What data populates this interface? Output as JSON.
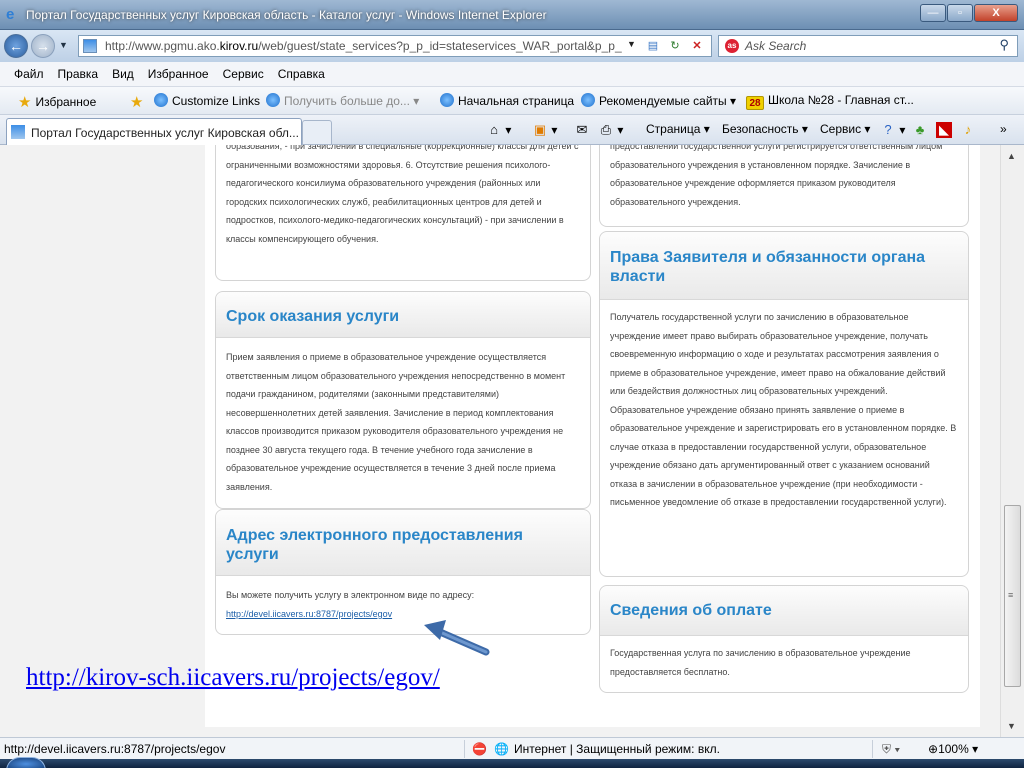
{
  "window": {
    "title": "Портал Государственных услуг Кировская область - Каталог услуг - Windows Internet Explorer",
    "minimize": "—",
    "maximize": "▫",
    "close": "X"
  },
  "address": {
    "url_prefix": "http://www.pgmu.ako.",
    "url_domain": "kirov.ru",
    "url_suffix": "/web/guest/state_services?p_p_id=stateservices_WAR_portal&p_p_",
    "search_placeholder": "Ask Search"
  },
  "menu": [
    "Файл",
    "Правка",
    "Вид",
    "Избранное",
    "Сервис",
    "Справка"
  ],
  "favorites": {
    "favorites_label": "Избранное",
    "items": [
      "Customize Links",
      "Получить больше до...",
      "Начальная страница",
      "Рекомендуемые сайты",
      "Школа №28 - Главная ст..."
    ],
    "badge_28": "28"
  },
  "tab": {
    "label": "Портал Государственных услуг Кировская обл..."
  },
  "commands": [
    "Страница",
    "Безопасность",
    "Сервис"
  ],
  "content": {
    "left_top_text": "образования, - при зачислении в специальные (коррекционные) классы для детей с ограниченными возможностями здоровья. 6. Отсутствие решения психолого-педагогического консилиума образовательного учреждения (районных или городских психологических служб, реабилитационных центров для детей и подростков, психолого-медико-педагогических консультаций) - при зачислении в классы компенсирующего обучения.",
    "srok": {
      "title": "Срок оказания услуги",
      "text": "Прием заявления о приеме в образовательное учреждение осуществляется ответственным лицом образовательного учреждения непосредственно в момент подачи гражданином, родителями (законными представителями) несовершеннолетних детей заявления. Зачисление в период комплектования классов производится приказом руководителя образовательного учреждения не позднее 30 августа текущего года. В течение учебного года зачисление в образовательное учреждение осуществляется в течение 3 дней после приема заявления."
    },
    "adres": {
      "title": "Адрес электронного предоставления услуги",
      "text": "Вы можете получить услугу в электронном виде по адресу:",
      "link": "http://devel.iicavers.ru:8787/projects/egov"
    },
    "right_top_text": "предоставлении государственной услуги регистрируется ответственным лицом образовательного учреждения в установленном порядке. Зачисление в образовательное учреждение оформляется приказом руководителя образовательного учреждения.",
    "prava": {
      "title": "Права Заявителя и обязанности органа власти",
      "text": "Получатель государственной услуги по зачислению в образовательное учреждение имеет право выбирать образовательное учреждение, получать своевременную информацию о ходе и результатах рассмотрения заявления о приеме в образовательное учреждение, имеет право на обжалование действий или бездействия должностных лиц образовательных учреждений. Образовательное учреждение обязано принять заявление о приеме в образовательное учреждение и зарегистрировать его в установленном порядке. В случае отказа в предоставлении государственной услуги, образовательное учреждение обязано дать аргументированный ответ с указанием оснований отказа в зачислении в образовательное учреждение (при необходимости - письменное уведомление об отказе в предоставлении государственной услуги)."
    },
    "oplata": {
      "title": "Сведения об оплате",
      "text": "Государственная услуга по зачислению в образовательное учреждение предоставляется бесплатно."
    }
  },
  "overlay_link": "http://kirov-sch.iicavers.ru/projects/egov/",
  "status": {
    "url": "http://devel.iicavers.ru:8787/projects/egov",
    "zone": "Интернет | Защищенный режим: вкл.",
    "zoom": "100%"
  }
}
